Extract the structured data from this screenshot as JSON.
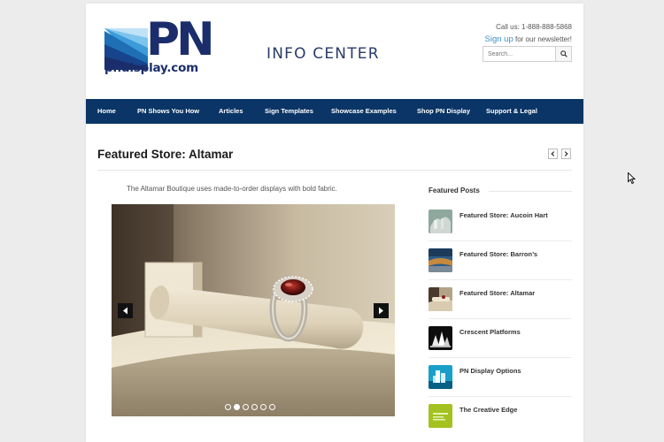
{
  "header": {
    "logo_text": "PN",
    "logo_url": "pndisplay.com",
    "site_section": "INFO CENTER",
    "call_us": "Call us: 1-888-888-5868",
    "signup_link": "Sign up",
    "signup_rest": " for our newsletter!",
    "search_placeholder": "Search..."
  },
  "nav": {
    "items": [
      {
        "label": "Home"
      },
      {
        "label": "PN Shows You How"
      },
      {
        "label": "Articles"
      },
      {
        "label": "Sign Templates"
      },
      {
        "label": "Showcase Examples"
      },
      {
        "label": "Shop PN Display"
      },
      {
        "label": "Support & Legal"
      }
    ]
  },
  "post": {
    "title": "Featured Store: Altamar",
    "excerpt": "The Altamar Boutique uses made-to-order displays with bold fabric.",
    "slider": {
      "slide_count": 6,
      "active_slide": 2
    }
  },
  "sidebar": {
    "heading": "Featured Posts",
    "posts": [
      {
        "title": "Featured Store: Aucoin Hart"
      },
      {
        "title": "Featured Store: Barron’s"
      },
      {
        "title": "Featured Store: Altamar"
      },
      {
        "title": "Crescent Platforms"
      },
      {
        "title": "PN Display Options"
      },
      {
        "title": "The Creative Edge"
      }
    ]
  },
  "colors": {
    "nav_bg": "#0a3566",
    "brand_navy": "#1b2e6b",
    "link_blue": "#3a8fc8",
    "page_bg": "#ececec"
  },
  "icons": {
    "search": "search-icon",
    "prev": "chevron-left-icon",
    "next": "chevron-right-icon"
  }
}
